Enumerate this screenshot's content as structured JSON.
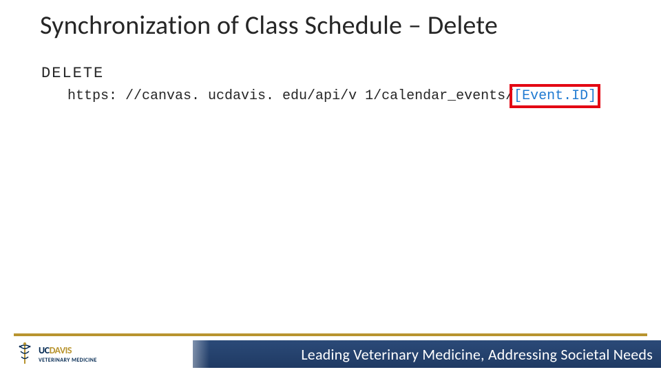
{
  "title": "Synchronization of Class Schedule – Delete",
  "request": {
    "method": "DELETE",
    "url_prefix": "https: //canvas. ucdavis. edu/api/v 1/calendar_events/",
    "param_open": "[",
    "param_name": "Event.ID",
    "param_close": "]"
  },
  "footer": {
    "logo": {
      "uc": "UC",
      "davis": "DAVIS",
      "sub": "VETERINARY MEDICINE"
    },
    "tagline": "Leading Veterinary Medicine, Addressing Societal Needs"
  }
}
